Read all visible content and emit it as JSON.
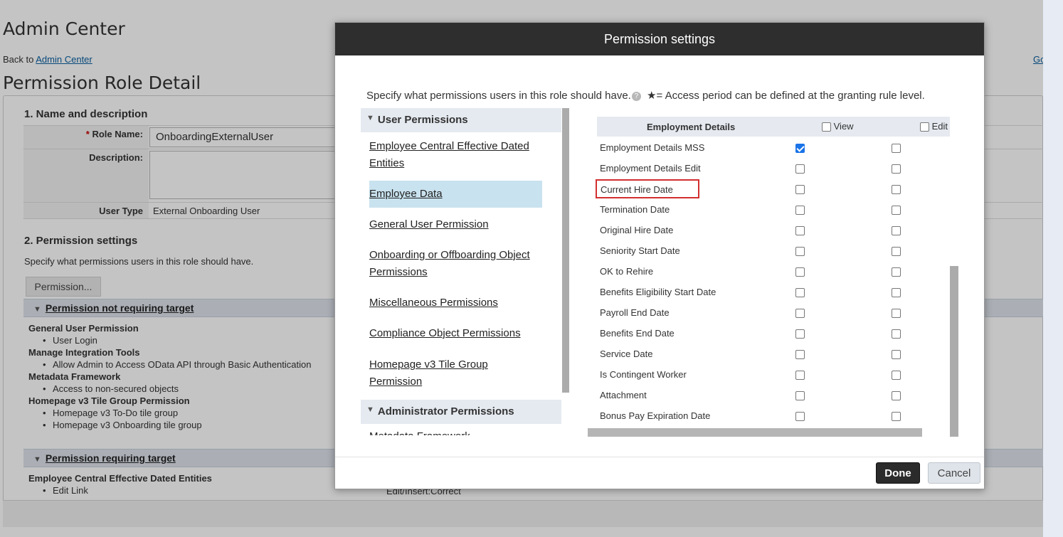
{
  "page": {
    "title": "Admin Center",
    "back_prefix": "Back to",
    "back_link": "Admin Center",
    "go_link": "Go",
    "role_detail_title": "Permission Role Detail",
    "section1": "1. Name and description",
    "role_name_label": "Role Name:",
    "role_name_value": "OnboardingExternalUser",
    "description_label": "Description:",
    "user_type_label": "User Type",
    "user_type_value": "External Onboarding User",
    "section2": "2. Permission settings",
    "section2_desc": "Specify what permissions users in this role should have.",
    "permission_button": "Permission...",
    "group_not_requiring": "Permission not requiring target",
    "not_requiring_list": [
      {
        "group": "General User Permission",
        "items": [
          "User Login"
        ]
      },
      {
        "group": "Manage Integration Tools",
        "items": [
          "Allow Admin to Access OData API through Basic Authentication"
        ]
      },
      {
        "group": "Metadata Framework",
        "items": [
          "Access to non-secured objects"
        ]
      },
      {
        "group": "Homepage v3 Tile Group Permission",
        "items": [
          "Homepage v3 To-Do tile group",
          "Homepage v3 Onboarding tile group"
        ]
      }
    ],
    "group_requiring": "Permission requiring target",
    "requiring_group": "Employee Central Effective Dated Entities",
    "requiring_item": "Edit Link",
    "requiring_value": "Edit/Insert:Correct"
  },
  "modal": {
    "title": "Permission settings",
    "intro": "Specify what permissions users in this role should have.",
    "intro_help": "?",
    "access_note": "★= Access period can be defined at the granting rule level.",
    "user_permissions_header": "User Permissions",
    "categories": [
      "Employee Central Effective Dated Entities",
      "Employee Data",
      "General User Permission",
      "Onboarding or Offboarding Object Permissions",
      "Miscellaneous Permissions",
      "Compliance Object Permissions",
      "Homepage v3 Tile Group Permission"
    ],
    "selected_category": "Employee Data",
    "admin_permissions_header": "Administrator Permissions",
    "admin_first_item": "Metadata Framework",
    "table": {
      "section": "Employment Details",
      "view_label": "View",
      "edit_label": "Edit",
      "rows": [
        {
          "label": "Employment Details MSS",
          "view": true,
          "edit": false
        },
        {
          "label": "Employment Details Edit",
          "view": false,
          "edit": false
        },
        {
          "label": "Current Hire Date",
          "view": false,
          "edit": false,
          "highlighted": true
        },
        {
          "label": "Termination Date",
          "view": false,
          "edit": false
        },
        {
          "label": "Original Hire Date",
          "view": false,
          "edit": false
        },
        {
          "label": "Seniority Start Date",
          "view": false,
          "edit": false
        },
        {
          "label": "OK to Rehire",
          "view": false,
          "edit": false
        },
        {
          "label": "Benefits Eligibility Start Date",
          "view": false,
          "edit": false
        },
        {
          "label": "Payroll End Date",
          "view": false,
          "edit": false
        },
        {
          "label": "Benefits End Date",
          "view": false,
          "edit": false
        },
        {
          "label": "Service Date",
          "view": false,
          "edit": false
        },
        {
          "label": "Is Contingent Worker",
          "view": false,
          "edit": false
        },
        {
          "label": "Attachment",
          "view": false,
          "edit": false
        },
        {
          "label": "Bonus Pay Expiration Date",
          "view": false,
          "edit": false
        }
      ]
    },
    "done_label": "Done",
    "cancel_label": "Cancel"
  },
  "colors": {
    "modal_header": "#2e2e2e",
    "selected_category": "#c9e2ef",
    "checkbox_checked": "#1a73e8",
    "highlight_box": "#d32f2f"
  }
}
